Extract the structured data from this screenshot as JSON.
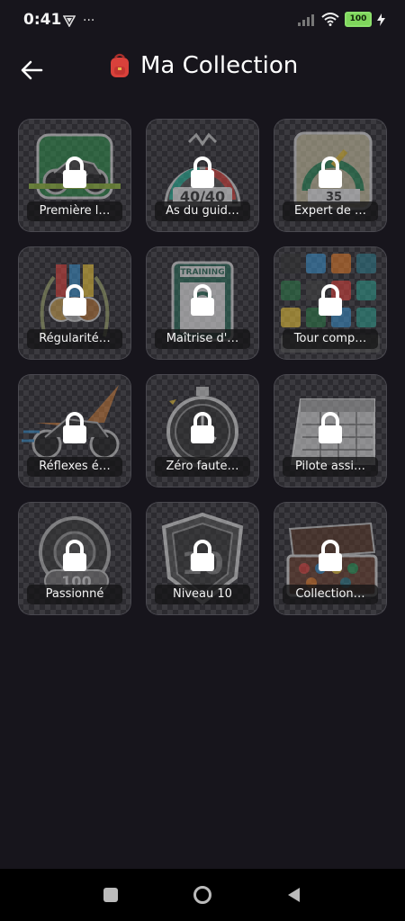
{
  "status_bar": {
    "time": "0:41",
    "more": "···",
    "battery": "100",
    "icons": [
      "vpn-shield-icon",
      "signal-icon",
      "wifi-icon",
      "battery-icon",
      "charging-icon"
    ]
  },
  "header": {
    "title": "Ma Collection",
    "back_icon": "back-arrow-icon",
    "title_icon": "backpack-icon"
  },
  "badges": [
    {
      "label": "Première l…",
      "locked": true,
      "art": "motorcycle"
    },
    {
      "label": "As du guid…",
      "locked": true,
      "art": "gauge"
    },
    {
      "label": "Expert de …",
      "locked": true,
      "art": "signs"
    },
    {
      "label": "Régularité…",
      "locked": true,
      "art": "medals"
    },
    {
      "label": "Maîtrise d'…",
      "locked": true,
      "art": "training"
    },
    {
      "label": "Tour comp…",
      "locked": true,
      "art": "icon-grid"
    },
    {
      "label": "Réflexes é…",
      "locked": true,
      "art": "bike-speed"
    },
    {
      "label": "Zéro faute…",
      "locked": true,
      "art": "stopwatch"
    },
    {
      "label": "Pilote assi…",
      "locked": true,
      "art": "calendar"
    },
    {
      "label": "Passionné",
      "locked": true,
      "art": "tire-100"
    },
    {
      "label": "Niveau 10",
      "locked": true,
      "art": "shield-10"
    },
    {
      "label": "Collection…",
      "locked": true,
      "art": "case"
    }
  ],
  "colors": {
    "background": "#17151c",
    "battery": "#7fd65c"
  }
}
